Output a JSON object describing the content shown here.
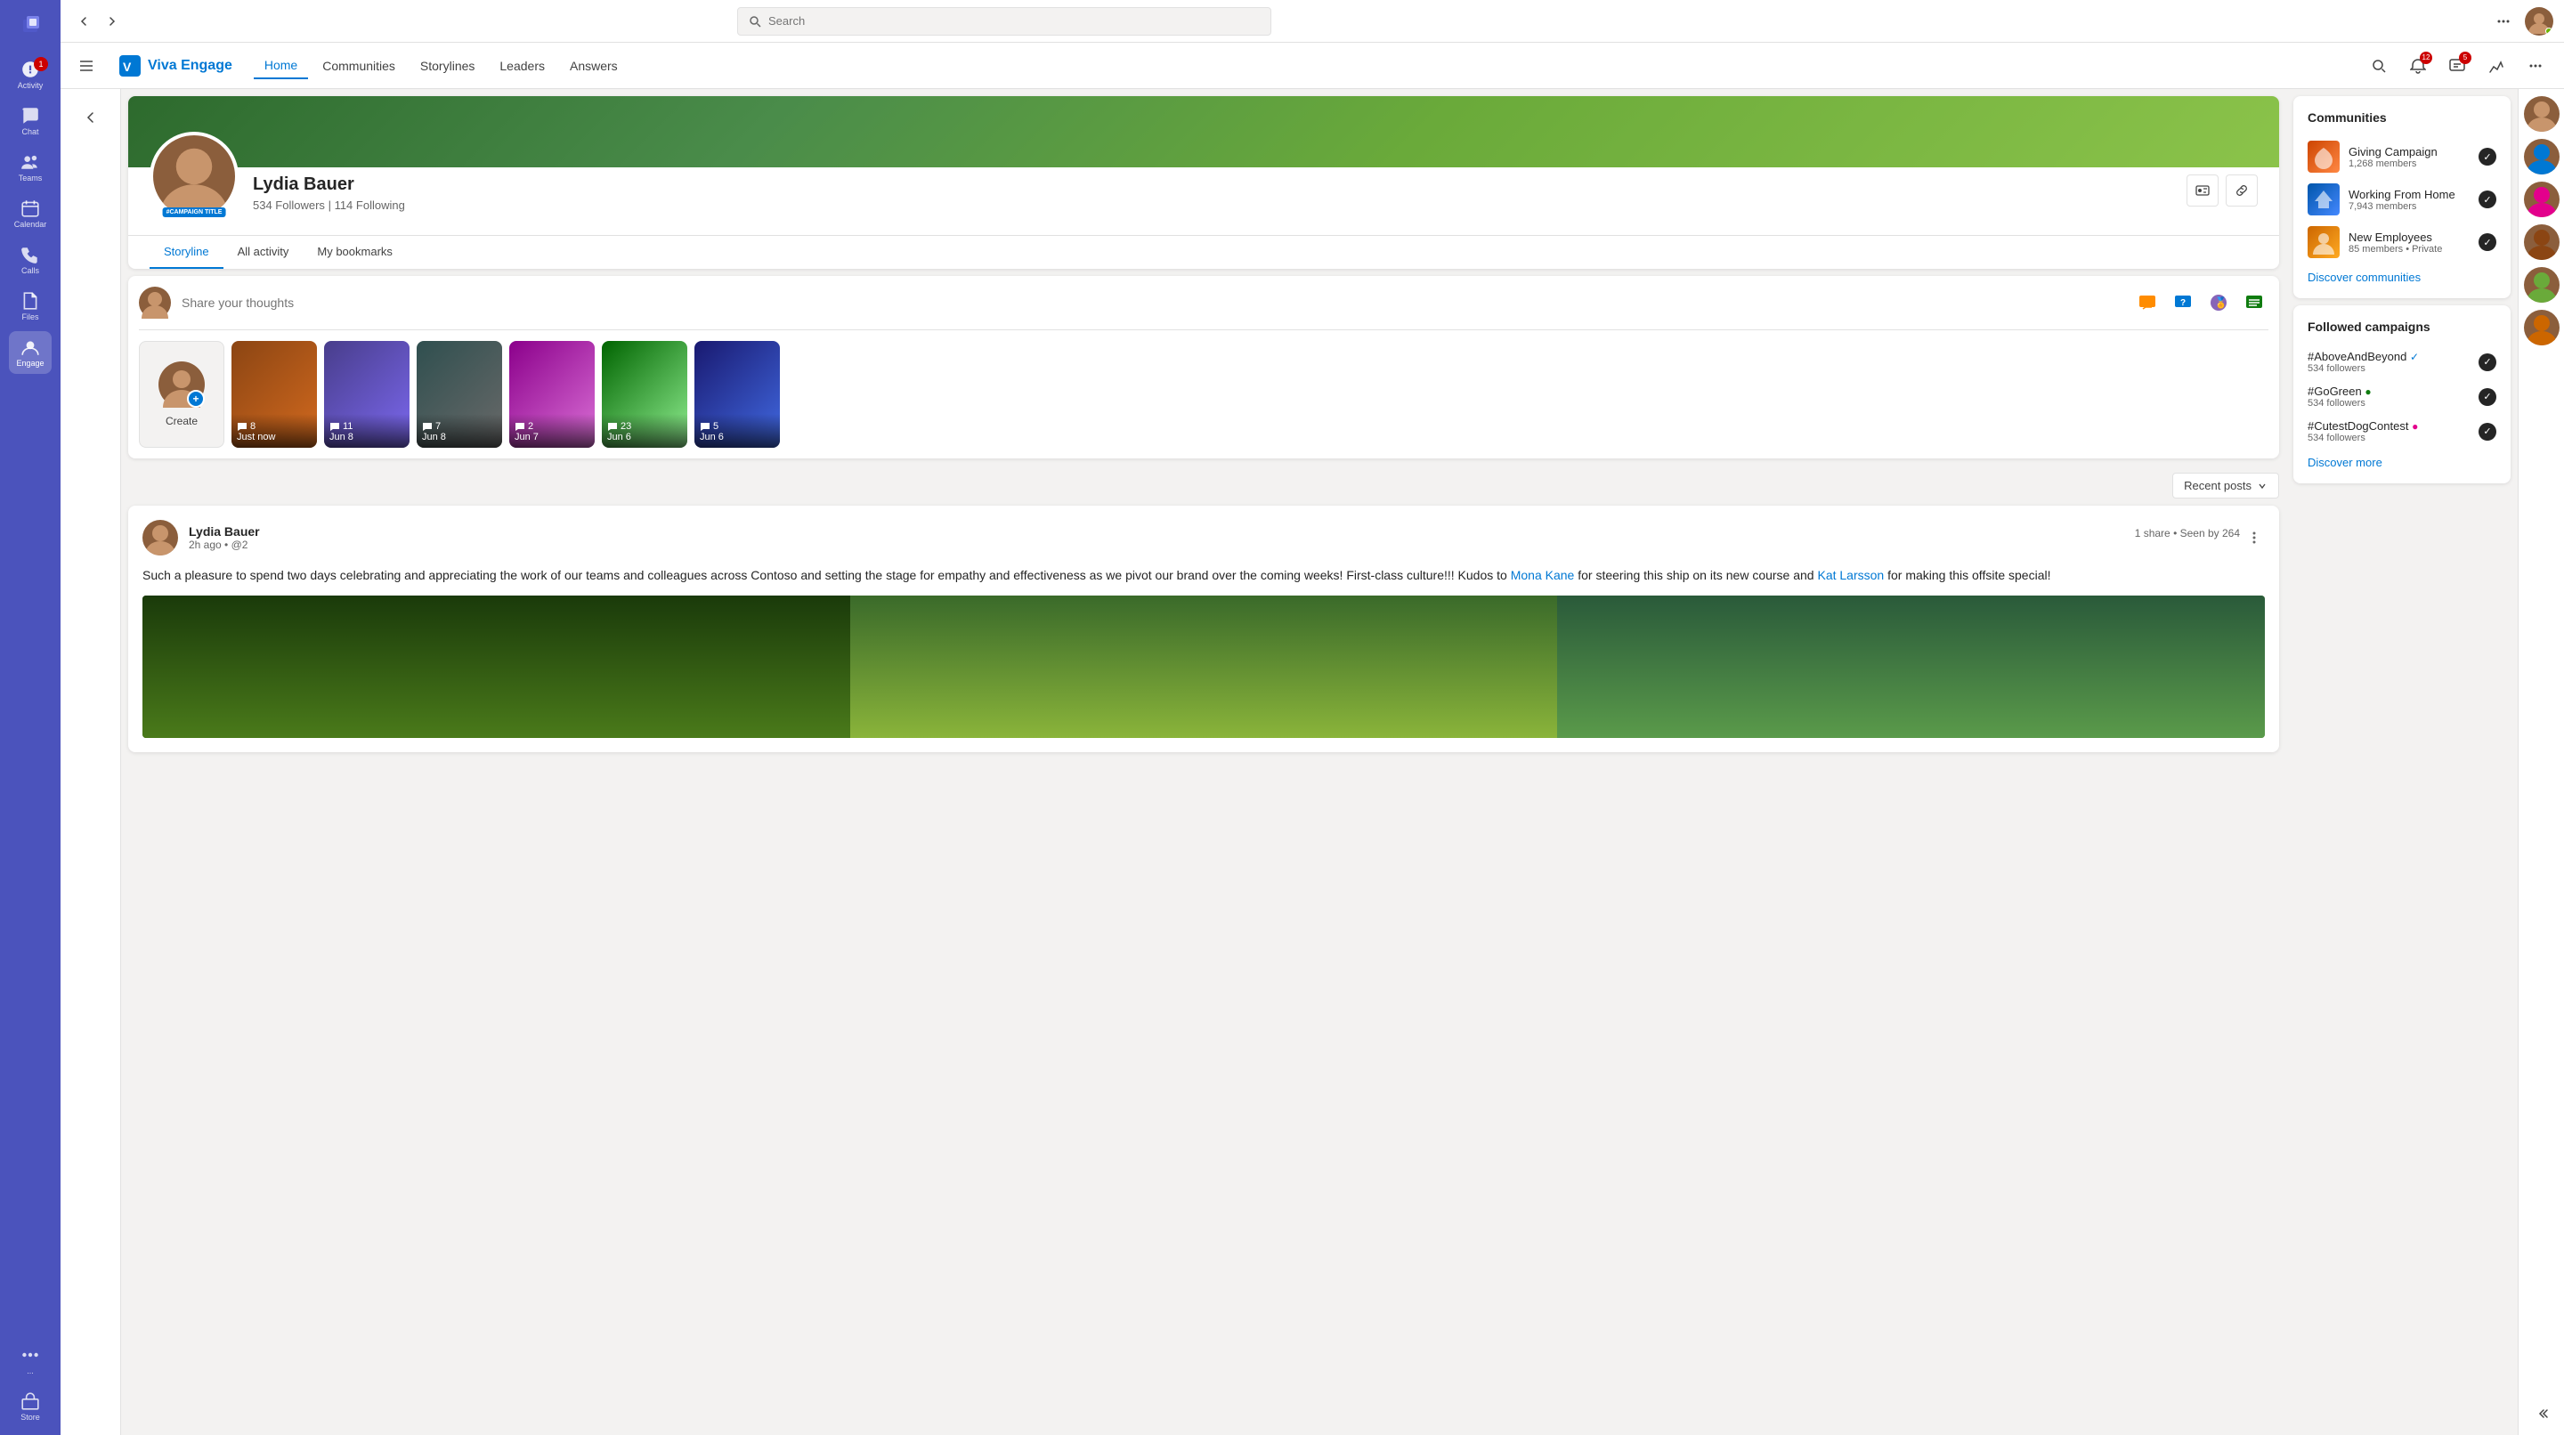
{
  "app": {
    "title": "Microsoft Teams"
  },
  "topBar": {
    "searchPlaceholder": "Search",
    "moreOptionsLabel": "...",
    "notificationBadge": "12",
    "msgBadge": "5"
  },
  "teamsNav": {
    "items": [
      {
        "id": "activity",
        "label": "Activity",
        "badge": "1"
      },
      {
        "id": "chat",
        "label": "Chat",
        "badge": null
      },
      {
        "id": "teams",
        "label": "Teams",
        "badge": null
      },
      {
        "id": "calendar",
        "label": "Calendar",
        "badge": null
      },
      {
        "id": "calls",
        "label": "Calls",
        "badge": null
      },
      {
        "id": "files",
        "label": "Files",
        "badge": null
      },
      {
        "id": "engage",
        "label": "Engage",
        "badge": null
      },
      {
        "id": "more",
        "label": "...",
        "badge": null
      },
      {
        "id": "store",
        "label": "Store",
        "badge": null
      }
    ]
  },
  "engageHeader": {
    "brand": "Viva Engage",
    "nav": [
      {
        "id": "home",
        "label": "Home",
        "active": true
      },
      {
        "id": "communities",
        "label": "Communities",
        "active": false
      },
      {
        "id": "storylines",
        "label": "Storylines",
        "active": false
      },
      {
        "id": "leaders",
        "label": "Leaders",
        "active": false
      },
      {
        "id": "answers",
        "label": "Answers",
        "active": false
      }
    ]
  },
  "profile": {
    "name": "Lydia Bauer",
    "followers": "534 Followers",
    "following": "114 Following",
    "campaignBadge": "#CAMPAIGN TITLE",
    "tabs": [
      {
        "id": "storyline",
        "label": "Storyline",
        "active": true
      },
      {
        "id": "allactivity",
        "label": "All activity",
        "active": false
      },
      {
        "id": "bookmarks",
        "label": "My bookmarks",
        "active": false
      }
    ]
  },
  "shareBox": {
    "placeholder": "Share your thoughts"
  },
  "storyThumbs": [
    {
      "id": "create",
      "label": "Create",
      "type": "create"
    },
    {
      "id": "just-now",
      "comments": "8",
      "date": "Just now",
      "type": "thumb",
      "bg": "thumb-bg-1"
    },
    {
      "id": "jun8a",
      "comments": "11",
      "date": "Jun 8",
      "type": "thumb",
      "bg": "thumb-bg-2"
    },
    {
      "id": "jun8b",
      "comments": "7",
      "date": "Jun 8",
      "type": "thumb",
      "bg": "thumb-bg-3"
    },
    {
      "id": "jun7",
      "comments": "2",
      "date": "Jun 7",
      "type": "thumb",
      "bg": "thumb-bg-4"
    },
    {
      "id": "jun6a",
      "comments": "23",
      "date": "Jun 6",
      "type": "thumb",
      "bg": "thumb-bg-5"
    },
    {
      "id": "jun6b",
      "comments": "5",
      "date": "Jun 6",
      "type": "thumb",
      "bg": "thumb-bg-6"
    }
  ],
  "recentPostsBtn": "Recent posts",
  "post": {
    "author": "Lydia Bauer",
    "time": "2h ago",
    "mention": "@2",
    "stats": "1 share  •  Seen by 264",
    "body": "Such a pleasure to spend two days celebrating and appreciating the work of our teams and colleagues across Contoso and setting the stage for empathy and effectiveness as we pivot our brand over the coming weeks! First-class culture!!! Kudos to",
    "link1": "Mona Kane",
    "bodyMid": " for steering this ship on its new course and ",
    "link2": "Kat Larsson",
    "bodyEnd": " for making this offsite special!"
  },
  "rightSidebar": {
    "communitiesTitle": "Communities",
    "communities": [
      {
        "id": "giving",
        "name": "Giving Campaign",
        "members": "1,268 members",
        "colorClass": "comm-giving"
      },
      {
        "id": "wfh",
        "name": "Working From Home",
        "members": "7,943 members",
        "colorClass": "comm-wfh"
      },
      {
        "id": "newempl",
        "name": "New Employees",
        "members": "85 members • Private",
        "colorClass": "comm-newempl"
      }
    ],
    "discoverCommLink": "Discover communities",
    "campaignsTitle": "Followed campaigns",
    "campaigns": [
      {
        "id": "beyond",
        "name": "#AboveAndBeyond",
        "followers": "534 followers",
        "dotColor": "blue"
      },
      {
        "id": "green",
        "name": "#GoGreen",
        "followers": "534 followers",
        "dotColor": "green"
      },
      {
        "id": "dog",
        "name": "#CutestDogContest",
        "followers": "534 followers",
        "dotColor": "pink"
      }
    ],
    "discoverMoreLink": "Discover more"
  },
  "farRight": {
    "avatars": [
      "av1",
      "av2",
      "av3",
      "av4",
      "av5",
      "av6"
    ],
    "collapseTitle": "Collapse"
  }
}
